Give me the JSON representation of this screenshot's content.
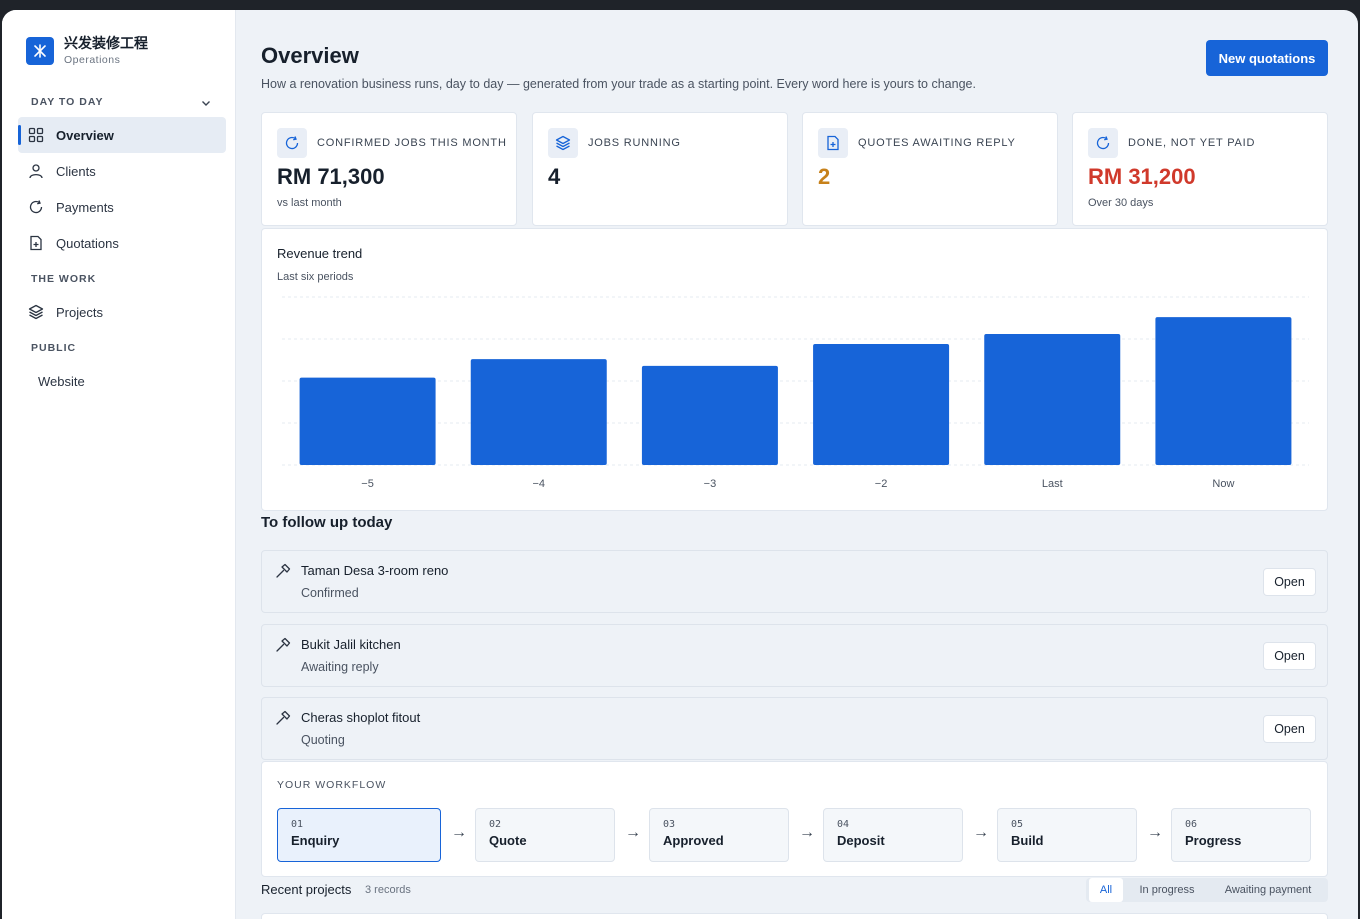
{
  "brand": {
    "name": "兴发装修工程",
    "subtitle": "Operations",
    "logo_icon": "x-star-icon",
    "accent": "#1764d8"
  },
  "sidebar": {
    "sections": [
      {
        "label": "DAY TO DAY"
      },
      {
        "label": "THE WORK"
      },
      {
        "label": "PUBLIC"
      }
    ],
    "items": [
      {
        "label": "Overview",
        "icon": "grid-icon",
        "active": true
      },
      {
        "label": "Clients",
        "icon": "user-icon"
      },
      {
        "label": "Payments",
        "icon": "refresh-icon"
      },
      {
        "label": "Quotations",
        "icon": "file-plus-icon"
      },
      {
        "label": "Projects",
        "icon": "layers-icon"
      },
      {
        "label": "Website",
        "icon": ""
      }
    ]
  },
  "header": {
    "title": "Overview",
    "subtitle": "How a renovation business runs, day to day — generated from your trade as a starting point. Every word here is yours to change.",
    "primary_action": "New quotations"
  },
  "stats": [
    {
      "label": "CONFIRMED JOBS THIS MONTH",
      "value": "RM 71,300",
      "note": "vs last month",
      "icon": "refresh-icon",
      "color": "#17202c"
    },
    {
      "label": "JOBS RUNNING",
      "value": "4",
      "note": "",
      "icon": "layers-icon",
      "color": "#17202c"
    },
    {
      "label": "QUOTES AWAITING REPLY",
      "value": "2",
      "note": "",
      "icon": "file-plus-icon",
      "color": "#c7811a"
    },
    {
      "label": "DONE, NOT YET PAID",
      "value": "RM 31,200",
      "note": "Over 30 days",
      "icon": "refresh-icon",
      "color": "#d0392b"
    }
  ],
  "chart": {
    "title": "Revenue trend",
    "subtitle": "Last six periods"
  },
  "chart_data": {
    "type": "bar",
    "title": "Revenue trend",
    "subtitle": "Last six periods",
    "categories": [
      "−5",
      "−4",
      "−3",
      "−2",
      "Last",
      "Now"
    ],
    "values": [
      52,
      63,
      59,
      72,
      78,
      88
    ],
    "ylim": [
      0,
      100
    ],
    "grid": true,
    "color": "#1764d8"
  },
  "followup": {
    "title": "To follow up today",
    "open_label": "Open",
    "tasks": [
      {
        "name": "Taman Desa 3-room reno",
        "status": "Confirmed",
        "icon": "hammer-icon"
      },
      {
        "name": "Bukit Jalil kitchen",
        "status": "Awaiting reply",
        "icon": "hammer-icon"
      },
      {
        "name": "Cheras shoplot fitout",
        "status": "Quoting",
        "icon": "hammer-icon"
      }
    ]
  },
  "workflow": {
    "label": "YOUR WORKFLOW",
    "arrow": "→",
    "steps": [
      {
        "num": "01",
        "name": "Enquiry",
        "active": true
      },
      {
        "num": "02",
        "name": "Quote"
      },
      {
        "num": "03",
        "name": "Approved"
      },
      {
        "num": "04",
        "name": "Deposit"
      },
      {
        "num": "05",
        "name": "Build"
      },
      {
        "num": "06",
        "name": "Progress"
      }
    ]
  },
  "recent": {
    "title": "Recent projects",
    "count": "3 records",
    "filters": [
      "All",
      "In progress",
      "Awaiting payment"
    ]
  }
}
